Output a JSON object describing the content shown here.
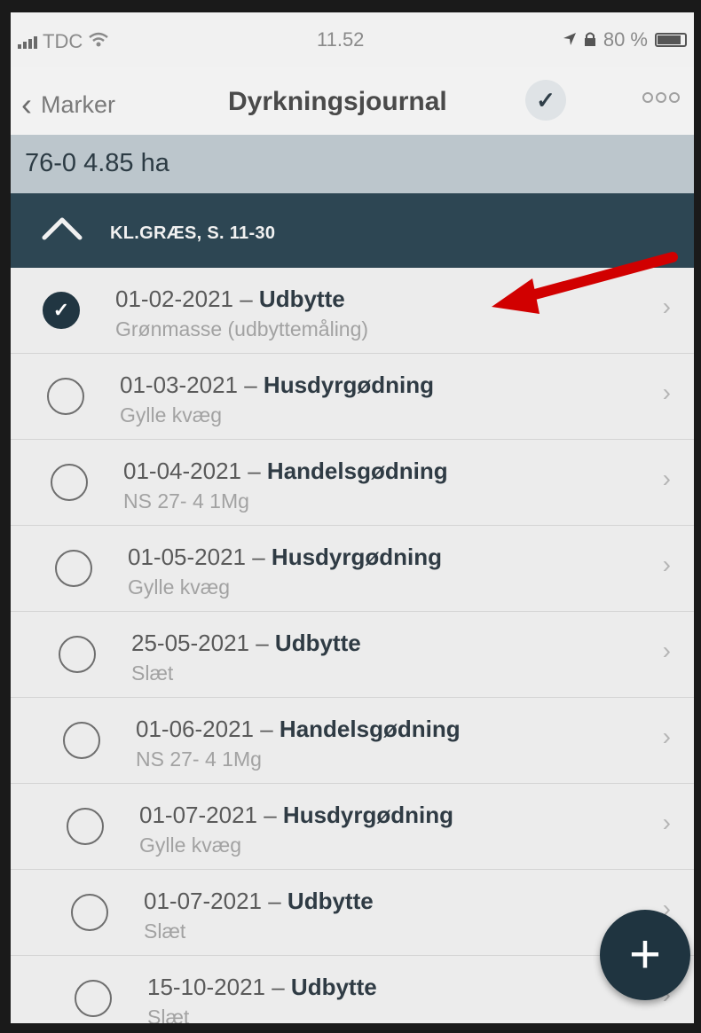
{
  "status_bar": {
    "carrier": "TDC",
    "time": "11.52",
    "battery": "80 %"
  },
  "nav": {
    "back_label": "Marker",
    "title": "Dyrkningsjournal"
  },
  "field": {
    "label": "76-0 4.85 ha"
  },
  "section": {
    "label": "KL.GRÆS, S. 11-30",
    "expanded": true
  },
  "entries": [
    {
      "date": "01-02-2021",
      "sep": " – ",
      "type": "Udbytte",
      "detail": "Grønmasse (udbyttemåling)",
      "checked": true
    },
    {
      "date": "01-03-2021",
      "sep": " – ",
      "type": "Husdyrgødning",
      "detail": "Gylle kvæg",
      "checked": false
    },
    {
      "date": "01-04-2021",
      "sep": " – ",
      "type": "Handelsgødning",
      "detail": "NS 27- 4 1Mg",
      "checked": false
    },
    {
      "date": "01-05-2021",
      "sep": " – ",
      "type": "Husdyrgødning",
      "detail": "Gylle kvæg",
      "checked": false
    },
    {
      "date": "25-05-2021",
      "sep": " – ",
      "type": "Udbytte",
      "detail": "Slæt",
      "checked": false
    },
    {
      "date": "01-06-2021",
      "sep": " – ",
      "type": "Handelsgødning",
      "detail": "NS 27- 4 1Mg",
      "checked": false
    },
    {
      "date": "01-07-2021",
      "sep": " – ",
      "type": "Husdyrgødning",
      "detail": "Gylle kvæg",
      "checked": false
    },
    {
      "date": "01-07-2021",
      "sep": " – ",
      "type": "Udbytte",
      "detail": "Slæt",
      "checked": false
    },
    {
      "date": "15-10-2021",
      "sep": " – ",
      "type": "Udbytte",
      "detail": "Slæt",
      "checked": false
    }
  ],
  "icons": {
    "check": "check-icon",
    "chevron": "chevron-right-icon",
    "add": "plus-icon",
    "more": "more-icon"
  },
  "colors": {
    "section_bg": "#2d4653",
    "field_header_bg": "#bcc6cc",
    "fab_bg": "#1f3440",
    "annotation_arrow": "#d10000"
  },
  "glyphs": {
    "check": "✓",
    "chevron": "›",
    "plus": "+",
    "back": "‹"
  }
}
